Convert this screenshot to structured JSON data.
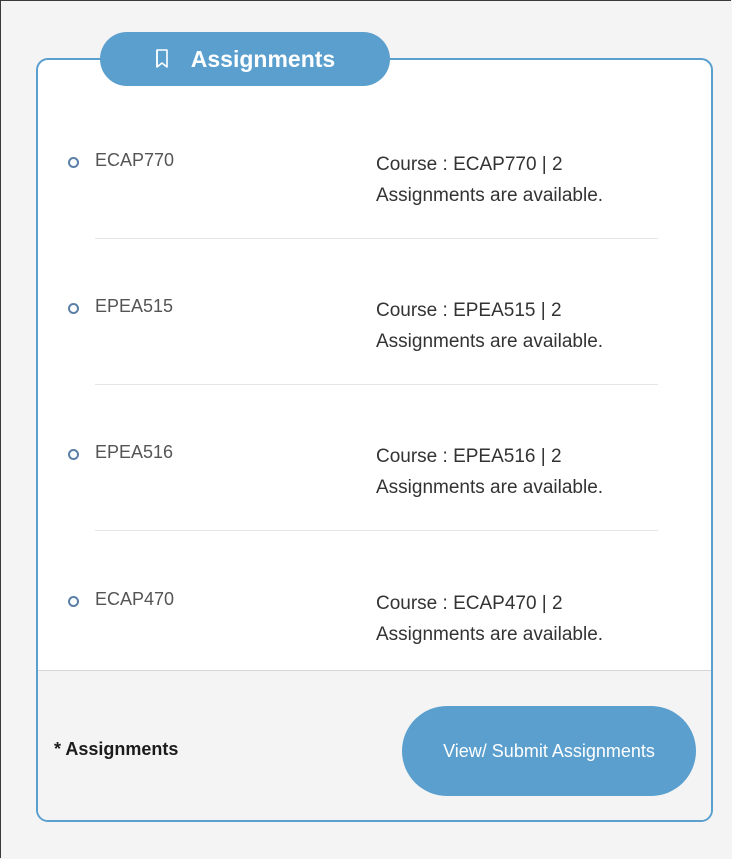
{
  "card": {
    "title": "Assignments",
    "title_icon": "bookmark-icon"
  },
  "items": [
    {
      "code": "ECAP770",
      "description": "Course : ECAP770 | 2 Assignments are available."
    },
    {
      "code": "EPEA515",
      "description": "Course : EPEA515 | 2 Assignments are available."
    },
    {
      "code": "EPEA516",
      "description": "Course : EPEA516 | 2 Assignments are available."
    },
    {
      "code": "ECAP470",
      "description": "Course : ECAP470 | 2 Assignments are available."
    }
  ],
  "footer": {
    "label": "* Assignments",
    "button_label": "View/ Submit Assignments"
  },
  "colors": {
    "accent": "#5a9fce",
    "bullet": "#5a7fa8"
  }
}
